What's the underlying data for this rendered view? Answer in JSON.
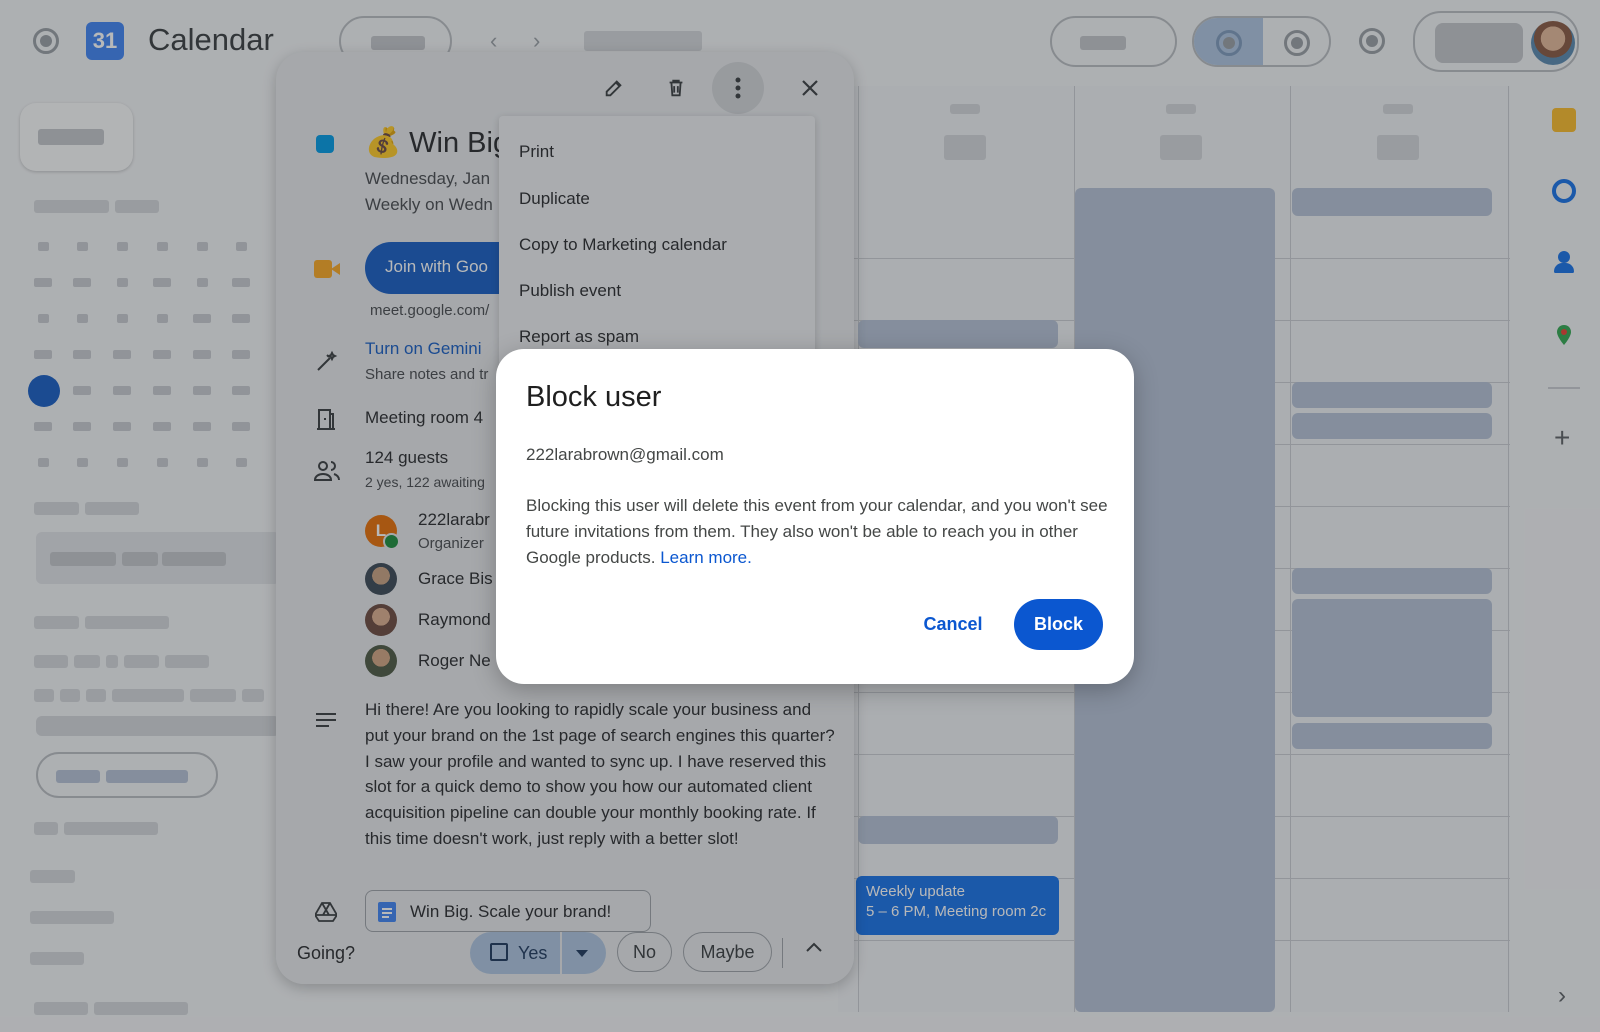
{
  "app": {
    "logo_day": "31",
    "title": "Calendar"
  },
  "popup": {
    "title": "Win Big",
    "title_emoji": "💰",
    "date_line": "Wednesday, Jan",
    "recurrence_line": "Weekly on Wedn",
    "join_button": "Join with Goo",
    "meet_link": "meet.google.com/",
    "gemini_link": "Turn on Gemini",
    "gemini_sub": "Share notes and tr",
    "room": "Meeting room 4",
    "guests_count": "124 guests",
    "guests_status": "2 yes, 122 awaiting",
    "guests": [
      {
        "name": "222larabr",
        "role": "Organizer",
        "initial": "L"
      },
      {
        "name": "Grace Bis"
      },
      {
        "name": "Raymond"
      },
      {
        "name": "Roger Ne"
      }
    ],
    "description": "Hi there! Are you looking to rapidly scale your business and put your brand on the 1st page of search engines this quarter? I saw your profile and wanted to sync up. I have reserved this slot for a quick demo to show you how our automated client acquisition pipeline can double your monthly booking rate. If this time doesn't work, just reply with a better slot!",
    "attachment": "Win Big. Scale your brand!",
    "going_label": "Going?",
    "rsvp_yes": "Yes",
    "rsvp_no": "No",
    "rsvp_maybe": "Maybe"
  },
  "menu": {
    "items": [
      "Print",
      "Duplicate",
      "Copy to Marketing calendar",
      "Publish event",
      "Report as spam"
    ]
  },
  "calendar_event": {
    "title": "Weekly update",
    "details": "5 – 6 PM, Meeting room 2c"
  },
  "dialog": {
    "title": "Block user",
    "email": "222larabrown@gmail.com",
    "body": "Blocking this user will delete this event from your calendar, and you won't see future invitations from them. They also won't be able to reach you in other Google products.",
    "link": "Learn more.",
    "cancel": "Cancel",
    "confirm": "Block"
  },
  "colors": {
    "primary": "#0b57d0",
    "event_blue": "#1a73e8",
    "event_square": "#039be5",
    "organizer_avatar": "#e8710a"
  }
}
